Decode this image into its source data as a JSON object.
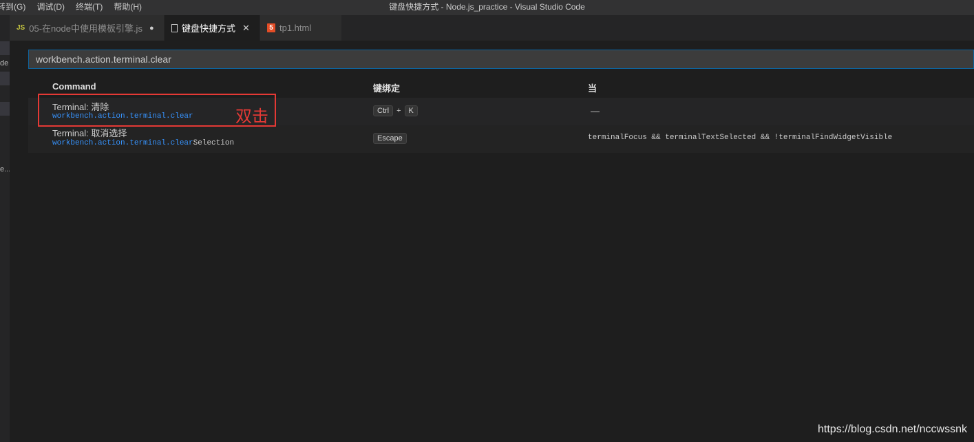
{
  "menu": [
    "转到(G)",
    "调试(D)",
    "终端(T)",
    "帮助(H)"
  ],
  "window_title": "键盘快捷方式 - Node.js_practice - Visual Studio Code",
  "sidebar_fragments": [
    "de",
    "e..."
  ],
  "tabs": [
    {
      "icon": "JS",
      "label": "05-在node中使用模板引擎.js",
      "indicator": "●"
    },
    {
      "icon": "file-icon",
      "label": "键盘快捷方式",
      "indicator": "✕"
    },
    {
      "icon": "5",
      "label": "tp1.html",
      "indicator": ""
    }
  ],
  "search": {
    "value": "workbench.action.terminal.clear",
    "placeholder": ""
  },
  "table": {
    "headers": {
      "command": "Command",
      "keybinding": "键绑定",
      "when": "当"
    },
    "rows": [
      {
        "title": "Terminal: 清除",
        "id_match": "workbench.action.terminal.clear",
        "id_rest": "",
        "keys": [
          "Ctrl",
          "K"
        ],
        "plus": "+",
        "when": "—"
      },
      {
        "title": "Terminal: 取消选择",
        "id_match": "workbench.action.terminal.clear",
        "id_rest": "Selection",
        "keys": [
          "Escape"
        ],
        "plus": "",
        "when": "terminalFocus && terminalTextSelected && !terminalFindWidgetVisible"
      }
    ]
  },
  "annotation": {
    "text": "双击",
    "color": "#e53935"
  },
  "watermark": "https://blog.csdn.net/nccwssnk",
  "colors": {
    "accent": "#3794ff",
    "focus_border": "#0e639c",
    "background": "#1e1e1e"
  }
}
